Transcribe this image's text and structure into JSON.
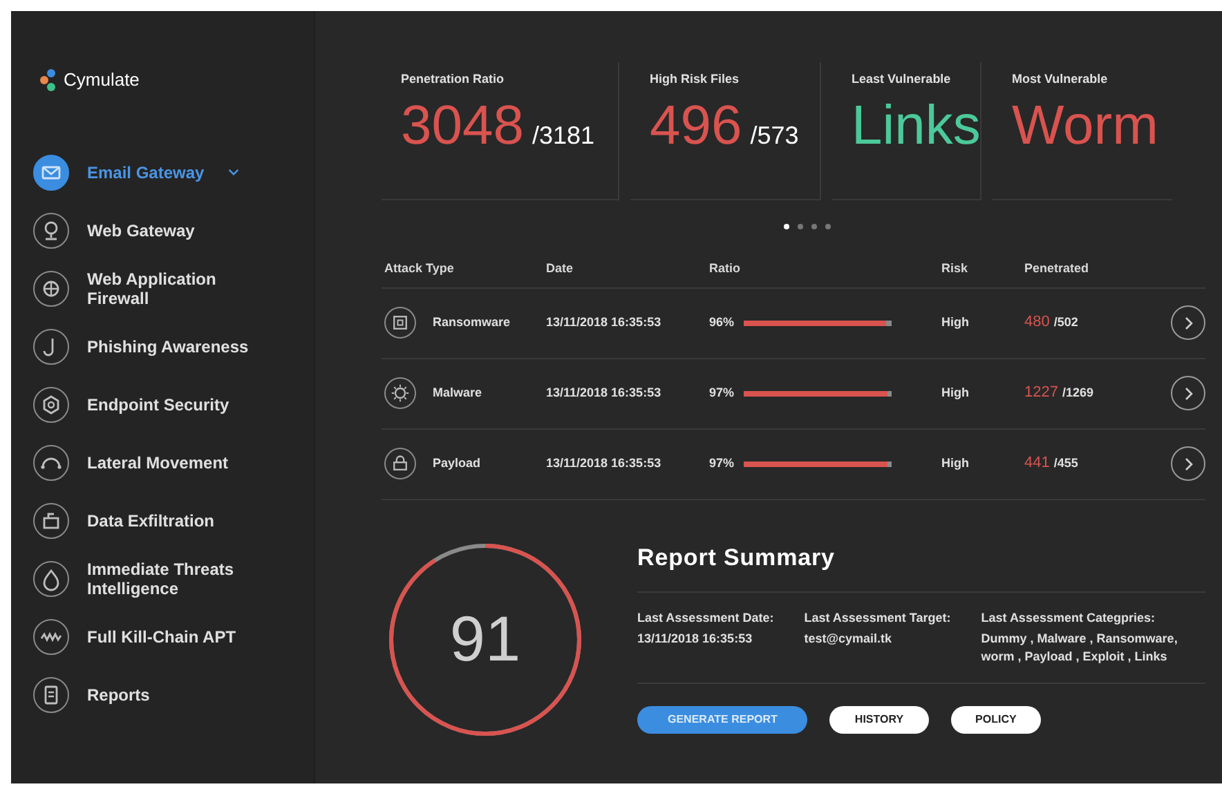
{
  "brand": {
    "name": "Cymulate"
  },
  "sidebar": {
    "items": [
      {
        "label": "Email Gateway",
        "selected": true
      },
      {
        "label": "Web Gateway",
        "selected": false
      },
      {
        "label": "Web Application Firewall",
        "selected": false
      },
      {
        "label": "Phishing Awareness",
        "selected": false
      },
      {
        "label": "Endpoint Security",
        "selected": false
      },
      {
        "label": "Lateral Movement",
        "selected": false
      },
      {
        "label": "Data Exfiltration",
        "selected": false
      },
      {
        "label": "Immediate Threats Intelligence",
        "selected": false
      },
      {
        "label": "Full Kill-Chain APT",
        "selected": false
      },
      {
        "label": "Reports",
        "selected": false
      }
    ]
  },
  "stats": [
    {
      "label": "Penetration Ratio",
      "value": "3048",
      "total": "/3181",
      "color": "#d9534f"
    },
    {
      "label": "High Risk Files",
      "value": "496",
      "total": "/573",
      "color": "#d9534f"
    },
    {
      "label": "Least Vulnerable",
      "value": "Links",
      "color": "#4cc99a"
    },
    {
      "label": "Most Vulnerable",
      "value": "Worm",
      "color": "#d9534f"
    }
  ],
  "carousel_dots": [
    {
      "selected": true
    },
    {
      "selected": false
    },
    {
      "selected": false
    },
    {
      "selected": false
    }
  ],
  "table": {
    "columns": [
      "Attack Type",
      "Date",
      "Ratio",
      "Risk",
      "Penetrated"
    ],
    "rows": [
      {
        "attack_type": "Ransomware",
        "date": "13/11/2018 16:35:53",
        "ratio": "96%",
        "level": 0.96,
        "risk": "High",
        "penetrated": "480",
        "total": "/502"
      },
      {
        "attack_type": "Malware",
        "date": "13/11/2018 16:35:53",
        "ratio": "97%",
        "level": 0.97,
        "risk": "High",
        "penetrated": "1227",
        "total": "/1269"
      },
      {
        "attack_type": "Payload",
        "date": "13/11/2018 16:35:53",
        "ratio": "97%",
        "level": 0.97,
        "risk": "High",
        "penetrated": "441",
        "total": "/455"
      }
    ]
  },
  "score": {
    "value": "91",
    "level": 0.91
  },
  "report_summary": {
    "title": "Report Summary",
    "fields": [
      {
        "label": "Last Assessment Date:",
        "value": "13/11/2018 16:35:53"
      },
      {
        "label": "Last Assessment Target:",
        "value": "test@cymail.tk"
      },
      {
        "label": "Last Assessment Categpries:",
        "value": "Dummy , Malware , Ransomware, worm , Payload , Exploit , Links"
      }
    ],
    "buttons": [
      {
        "label": "GENERATE REPORT",
        "kind": "primary"
      },
      {
        "label": "HISTORY",
        "kind": "secondary"
      },
      {
        "label": "POLICY",
        "kind": "secondary"
      }
    ]
  }
}
